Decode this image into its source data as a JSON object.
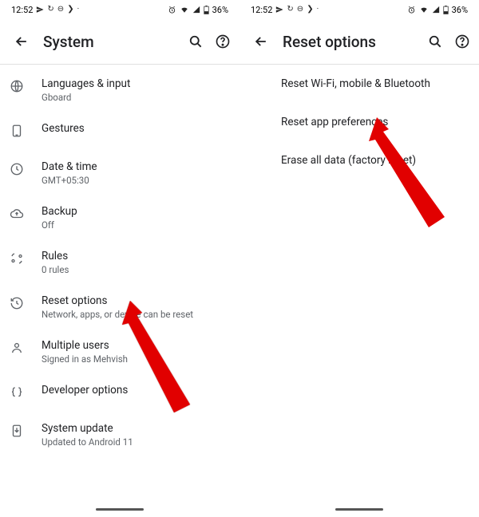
{
  "statusbar": {
    "time": "12:52",
    "battery": "36%"
  },
  "left": {
    "title": "System",
    "items": [
      {
        "icon": "globe",
        "primary": "Languages & input",
        "secondary": "Gboard"
      },
      {
        "icon": "gesture",
        "primary": "Gestures",
        "secondary": ""
      },
      {
        "icon": "clock",
        "primary": "Date & time",
        "secondary": "GMT+05:30"
      },
      {
        "icon": "cloud",
        "primary": "Backup",
        "secondary": "Off"
      },
      {
        "icon": "rules",
        "primary": "Rules",
        "secondary": "0 rules"
      },
      {
        "icon": "history",
        "primary": "Reset options",
        "secondary": "Network, apps, or device can be reset"
      },
      {
        "icon": "users",
        "primary": "Multiple users",
        "secondary": "Signed in as Mehvish"
      },
      {
        "icon": "braces",
        "primary": "Developer options",
        "secondary": ""
      },
      {
        "icon": "update",
        "primary": "System update",
        "secondary": "Updated to Android 11"
      }
    ]
  },
  "right": {
    "title": "Reset options",
    "items": [
      {
        "primary": "Reset Wi-Fi, mobile & Bluetooth"
      },
      {
        "primary": "Reset app preferences"
      },
      {
        "primary": "Erase all data (factory reset)"
      }
    ]
  }
}
